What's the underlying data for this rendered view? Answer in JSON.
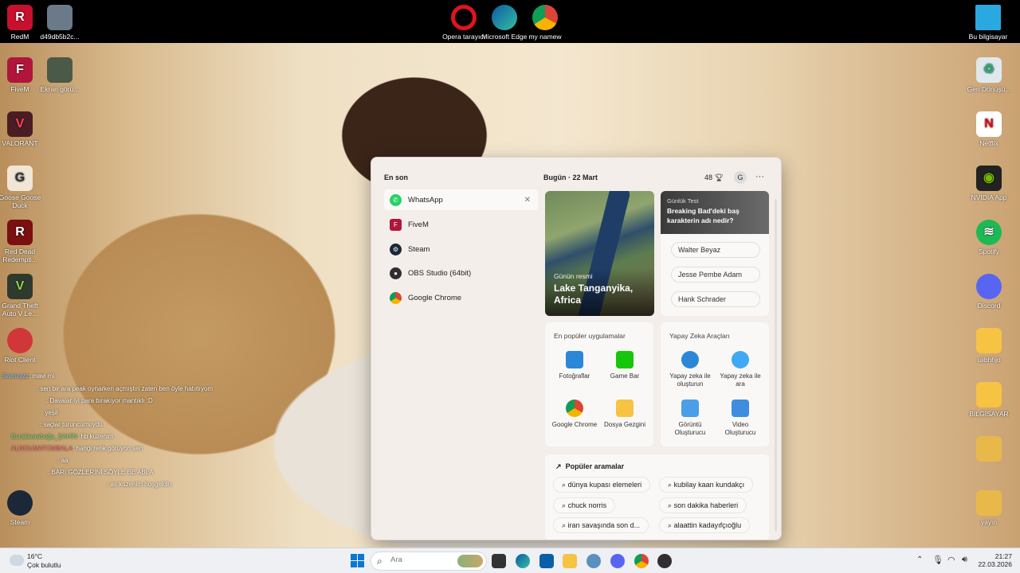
{
  "desktop_icons": {
    "top": [
      {
        "label": "RedM"
      },
      {
        "label": "d49db5b2c..."
      },
      {
        "label": "Opera tarayıcı"
      },
      {
        "label": "Microsoft Edge"
      },
      {
        "label": "my namew"
      },
      {
        "label": "Bu bilgisayar"
      }
    ],
    "left": [
      {
        "label": "FiveM"
      },
      {
        "label": "Ekran görü..."
      },
      {
        "label": "VALORANT"
      },
      {
        "label": "Goose Goose Duck"
      },
      {
        "label": "Red Dead Redempti..."
      },
      {
        "label": "Grand Theft Auto V Le..."
      },
      {
        "label": "Riot Client"
      },
      {
        "label": "Steam"
      }
    ],
    "right": [
      {
        "label": "Geri Dönüşü..."
      },
      {
        "label": "Netflix"
      },
      {
        "label": "NVIDIA App"
      },
      {
        "label": "Spotify"
      },
      {
        "label": "Discord"
      },
      {
        "label": "uiibhhjo"
      },
      {
        "label": "BİLGİSAYAR"
      },
      {
        "label": "yayın"
      }
    ]
  },
  "chat_overlay": [
    {
      "user": "Swroxyzz",
      "msg": ": mavi mi"
    },
    {
      "user": "",
      "msg": ": sen bir ara peak oynarken açmıştın zaten ben öyle hatırlıyom"
    },
    {
      "user": "",
      "msg": ": Davalar iyi para bırakıyor mantıklı :D"
    },
    {
      "user": "",
      "msg": ": yeşil"
    },
    {
      "user": "",
      "msg": ": saçlar turuncumuydu"
    },
    {
      "user": "Burakkaraboğa_ŞAHİN",
      "msg": ": hb kuzenim"
    },
    {
      "user": "ALNOUMATOMBALA",
      "msg": ": hangi renk görüyon sen"
    },
    {
      "user": "",
      "msg": ": aa"
    },
    {
      "user": "",
      "msg": ": BARİ GÖZLERİNİ SÖYLE BE ABLA"
    },
    {
      "user": "",
      "msg": ": as kuzenim hoşgeldin"
    }
  ],
  "start_menu": {
    "recent_title": "En son",
    "recent_items": [
      {
        "label": "WhatsApp",
        "icon": "whatsapp-icon",
        "color": "#25D366"
      },
      {
        "label": "FiveM",
        "icon": "fivem-icon",
        "color": "#b0163b"
      },
      {
        "label": "Steam",
        "icon": "steam-icon",
        "color": "#1b2838"
      },
      {
        "label": "OBS Studio (64bit)",
        "icon": "obs-icon",
        "color": "#302e31"
      },
      {
        "label": "Google Chrome",
        "icon": "chrome-icon",
        "color": "#db4437"
      }
    ],
    "today_label": "Bugün",
    "date_label": "22 Mart",
    "points": "48",
    "avatar_letter": "G",
    "image_of_day": {
      "caption": "Günün resmi",
      "title": "Lake Tanganyika, Africa"
    },
    "quiz": {
      "caption": "Günlük Test",
      "question": "Breaking Bad'deki baş karakterin adı nedir?",
      "answers": [
        "Walter Beyaz",
        "Jesse Pembe Adam",
        "Hank Schrader"
      ]
    },
    "popular_apps": {
      "title": "En popüler uygulamalar",
      "items": [
        {
          "label": "Fotoğraflar",
          "color": "#2b88d8"
        },
        {
          "label": "Game Bar",
          "color": "#16c60c"
        },
        {
          "label": "Google Chrome",
          "color": "#db4437"
        },
        {
          "label": "Dosya Gezgini",
          "color": "#f6c343"
        }
      ]
    },
    "ai_tools": {
      "title": "Yapay Zeka Araçları",
      "items": [
        {
          "label": "Yapay zeka ile oluşturun",
          "color": "#2b88d8"
        },
        {
          "label": "Yapay zeka ile ara",
          "color": "#3fa9f5"
        },
        {
          "label": "Görüntü Oluşturucu",
          "color": "#4a9fe8"
        },
        {
          "label": "Video Oluşturucu",
          "color": "#3f8de0"
        }
      ]
    },
    "popular_searches": {
      "title": "Popüler aramalar",
      "items": [
        "dünya kupası elemeleri",
        "kubilay kaan kundakçı",
        "chuck norris",
        "son dakika haberleri",
        "iran savaşında son d...",
        "alaattin kadayıfçıoğlu"
      ]
    }
  },
  "taskbar": {
    "weather_temp": "16°C",
    "weather_desc": "Çok bulutlu",
    "search_placeholder": "Ara",
    "time": "21:27",
    "date": "22.03.2026"
  }
}
